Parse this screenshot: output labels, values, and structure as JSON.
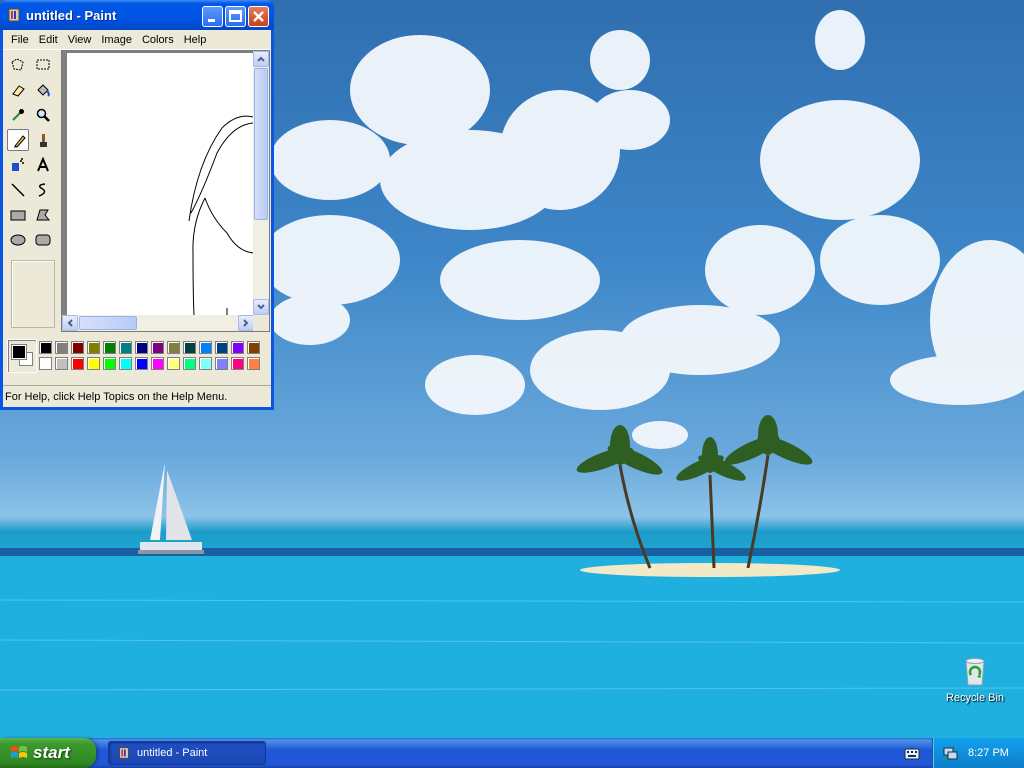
{
  "window": {
    "title": "untitled - Paint",
    "menus": [
      "File",
      "Edit",
      "View",
      "Image",
      "Colors",
      "Help"
    ],
    "status_text": "For Help, click Help Topics on the Help Menu.",
    "selected_tool": "pencil",
    "foreground_color": "#000000",
    "background_color": "#ffffff",
    "palette_top": [
      "#000000",
      "#808080",
      "#800000",
      "#808000",
      "#008000",
      "#008080",
      "#000080",
      "#800080",
      "#808040",
      "#004040",
      "#0080ff",
      "#004080",
      "#8000ff",
      "#804000"
    ],
    "palette_bottom": [
      "#ffffff",
      "#c0c0c0",
      "#ff0000",
      "#ffff00",
      "#00ff00",
      "#00ffff",
      "#0000ff",
      "#ff00ff",
      "#ffff80",
      "#00ff80",
      "#80ffff",
      "#8080ff",
      "#ff0080",
      "#ff8040"
    ]
  },
  "desktop": {
    "recycle_bin_label": "Recycle Bin"
  },
  "taskbar": {
    "start_label": "start",
    "task_button_label": "untitled - Paint",
    "clock": "8:27 PM"
  },
  "colors": {
    "titlebar_blue": "#0054e3",
    "start_green": "#3c9a2d",
    "taskbar_blue": "#2157d7",
    "tray_blue": "#0f8fdc"
  }
}
